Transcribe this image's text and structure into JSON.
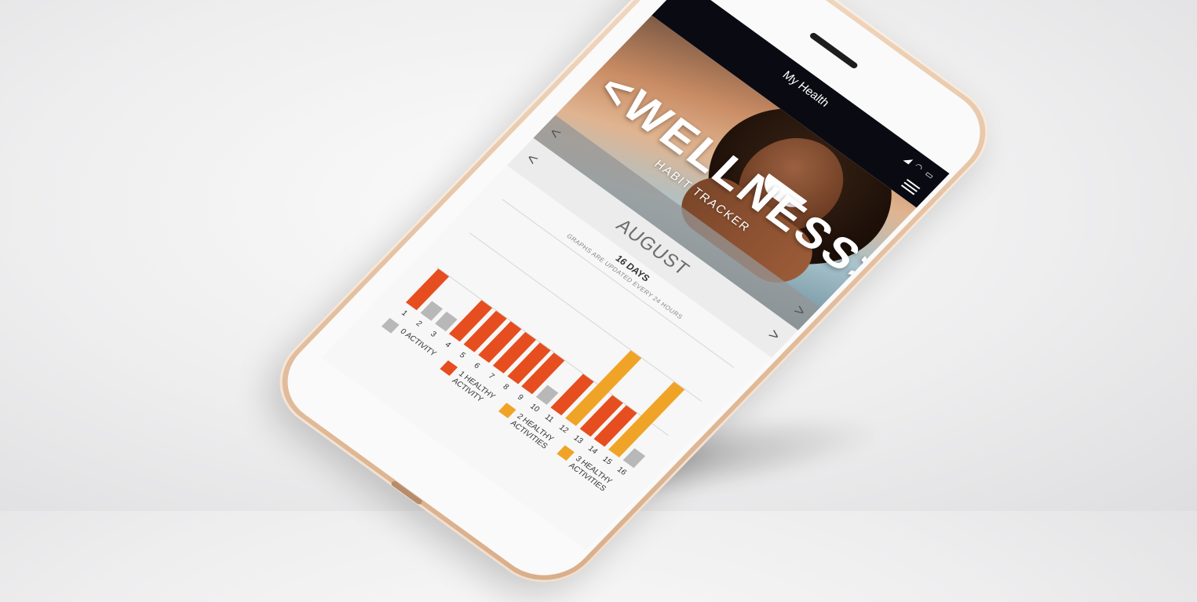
{
  "app": {
    "title": "My Health",
    "status_icons": "◢ ◠ ▭"
  },
  "hero": {
    "title": "<WELLNESS>",
    "subtitle": "HABIT TRACKER",
    "prev_arrow": "<",
    "next_arrow": ">"
  },
  "month": {
    "label": "AUGUST",
    "prev_arrow": "<",
    "next_arrow": ">",
    "days_count": "16 DAYS",
    "update_note": "GRAPHS ARE UPDATED EVERY 24 HOURS"
  },
  "colors": {
    "zero": "#b8b8b8",
    "one": "#e64e1f",
    "two": "#f0a427",
    "three": "#f0a427",
    "topbar": "#0a0a12"
  },
  "chart_data": {
    "type": "bar",
    "categories": [
      "1",
      "2",
      "3",
      "4",
      "5",
      "6",
      "7",
      "8",
      "9",
      "10",
      "11",
      "12",
      "13",
      "14",
      "15",
      "16"
    ],
    "values": [
      1,
      0,
      0,
      1,
      1,
      1,
      1,
      1,
      1,
      0,
      1,
      2,
      1,
      1,
      2,
      0
    ],
    "ylim": [
      0,
      3
    ],
    "legend_placement": "bottom"
  },
  "legend": [
    {
      "label": "0 ACTIVITY",
      "color_key": "zero"
    },
    {
      "label": "1 HEALTHY ACTIVITY",
      "color_key": "one"
    },
    {
      "label": "2 HEALTHY ACTIVITIES",
      "color_key": "two"
    },
    {
      "label": "3 HEALTHY ACTIVITIES",
      "color_key": "three"
    }
  ]
}
